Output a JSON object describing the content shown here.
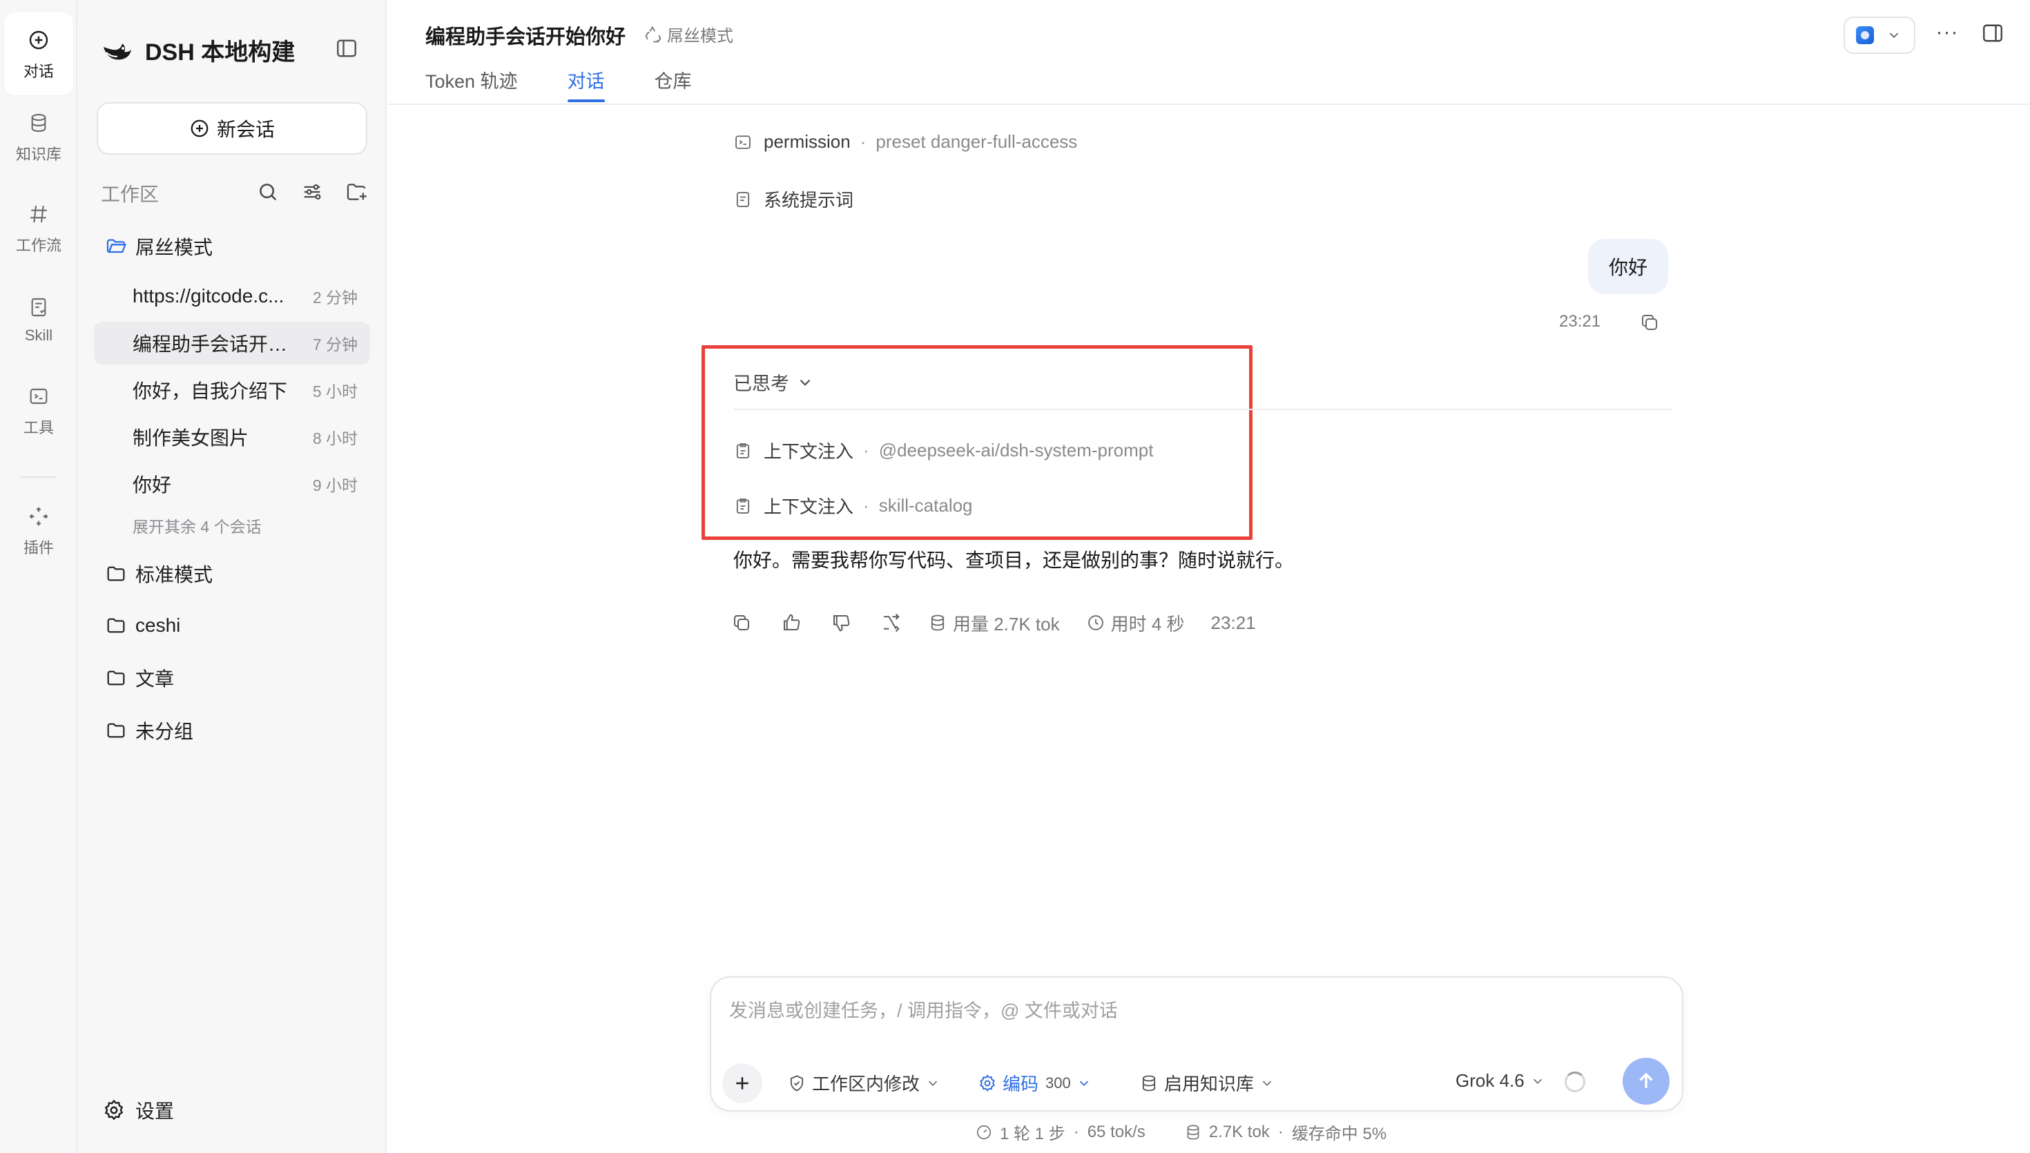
{
  "rail": {
    "items": [
      {
        "label": "对话",
        "icon": "plus-circle-icon"
      },
      {
        "label": "知识库",
        "icon": "database-icon"
      },
      {
        "label": "工作流",
        "icon": "hash-icon"
      },
      {
        "label": "Skill",
        "icon": "skill-icon"
      },
      {
        "label": "工具",
        "icon": "terminal-icon"
      },
      {
        "label": "插件",
        "icon": "move-icon"
      }
    ]
  },
  "sidebar": {
    "brand": "DSH 本地构建",
    "new_chat": "新会话",
    "workspace_title": "工作区",
    "folders": [
      {
        "name": "屌丝模式"
      },
      {
        "name": "标准模式"
      },
      {
        "name": "ceshi"
      },
      {
        "name": "文章"
      },
      {
        "name": "未分组"
      }
    ],
    "conversations": [
      {
        "title": "https://gitcode.c...",
        "time": "2 分钟"
      },
      {
        "title": "编程助手会话开始...",
        "time": "7 分钟"
      },
      {
        "title": "你好，自我介绍下",
        "time": "5 小时"
      },
      {
        "title": "制作美女图片",
        "time": "8 小时"
      },
      {
        "title": "你好",
        "time": "9 小时"
      }
    ],
    "expand_more": "展开其余 4 个会话",
    "settings": "设置"
  },
  "header": {
    "title": "编程助手会话开始你好",
    "mode": "屌丝模式",
    "tabs": [
      "Token 轨迹",
      "对话",
      "仓库"
    ],
    "active_tab": 1,
    "more": "···"
  },
  "chat": {
    "permission_label": "permission",
    "permission_value": "preset danger-full-access",
    "system_prompt": "系统提示词",
    "user_message": "你好",
    "user_time": "23:21",
    "thought_label": "已思考",
    "context_injections": [
      {
        "label": "上下文注入",
        "value": "@deepseek-ai/dsh-system-prompt"
      },
      {
        "label": "上下文注入",
        "value": "skill-catalog"
      }
    ],
    "reply": "你好。需要我帮你写代码、查项目，还是做别的事？随时说就行。",
    "usage": "用量 2.7K tok",
    "duration": "用时 4 秒",
    "reply_time": "23:21"
  },
  "composer": {
    "placeholder": "发消息或创建任务，/ 调用指令，@ 文件或对话",
    "workspace_edit": "工作区内修改",
    "mode": "编码",
    "mode_count": "300",
    "knowledge": "启用知识库",
    "model": "Grok 4.6"
  },
  "footer": {
    "rounds": "1 轮 1 步",
    "speed": "65 tok/s",
    "tokens": "2.7K tok",
    "cache": "缓存命中 5%"
  },
  "colors": {
    "accent": "#2f6fe4",
    "highlight": "#e8413c",
    "send": "#9db8f6"
  }
}
